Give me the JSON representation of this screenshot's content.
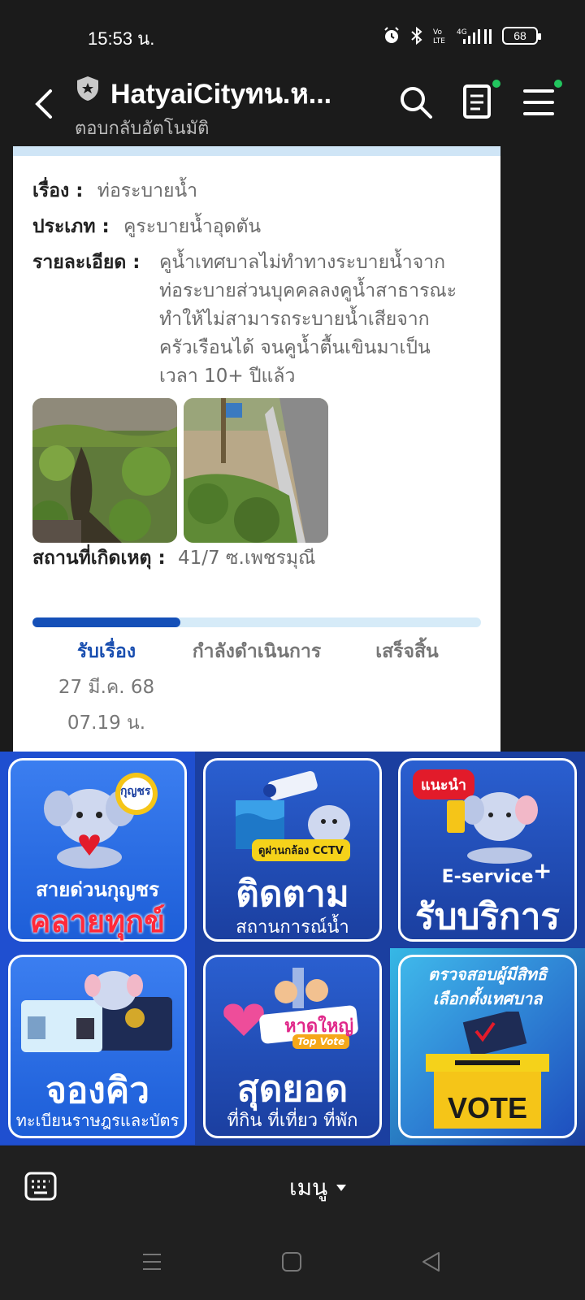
{
  "status_bar": {
    "time": "15:53 น.",
    "battery": "68"
  },
  "header": {
    "title": "HatyaiCityทน.ห...",
    "subtitle": "ตอบกลับอัตโนมัติ"
  },
  "complaint": {
    "subject_label": "เรื่อง :",
    "subject_value": "ท่อระบายน้ำ",
    "type_label": "ประเภท :",
    "type_value": "คูระบายน้ำอุดตัน",
    "detail_label": "รายละเอียด :",
    "detail_lines": [
      "คูน้ำเทศบาลไม่ทำทางระบายน้ำจาก",
      "ท่อระบายส่วนบุคคลลงคูน้ำสาธารณะ",
      "ทำให้ไม่สามารถระบายน้ำเสียจาก",
      "ครัวเรือนได้ จนคูน้ำตื้นเขินมาเป็น",
      "เวลา 10+ ปีแล้ว"
    ],
    "location_label": "สถานที่เกิดเหตุ :",
    "location_value": "41/7 ซ.เพชรมุณี"
  },
  "progress": {
    "fraction": 0.33,
    "steps": [
      "รับเรื่อง",
      "กำลังดำเนินการ",
      "เสร็จสิ้น"
    ],
    "date": "27 มี.ค. 68",
    "time": "07.19 น."
  },
  "rich_menu": {
    "tile1": {
      "small": "สายด่วนกุญชร",
      "big": "คลายทุกข์",
      "badge": "กุญชร"
    },
    "tile2": {
      "big": "ติดตาม",
      "small": "สถานการณ์น้ำ",
      "badge": "ดูผ่านกล้อง CCTV"
    },
    "tile3": {
      "badge": "แนะนำ",
      "small": "E-service",
      "big": "รับบริการ"
    },
    "tile4": {
      "big": "จองคิว",
      "small": "ทะเบียนราษฎรและบัตร"
    },
    "tile5": {
      "big": "สุดยอด",
      "small": "ที่กิน ที่เที่ยว ที่พัก",
      "badge": "หาดใหญ่",
      "badge2": "Top Vote"
    },
    "tile6": {
      "line1": "ตรวจสอบผู้มีสิทธิ",
      "line2": "เลือกตั้งเทศบาล",
      "vote": "VOTE"
    }
  },
  "menu_bar": {
    "label": "เมนู"
  }
}
